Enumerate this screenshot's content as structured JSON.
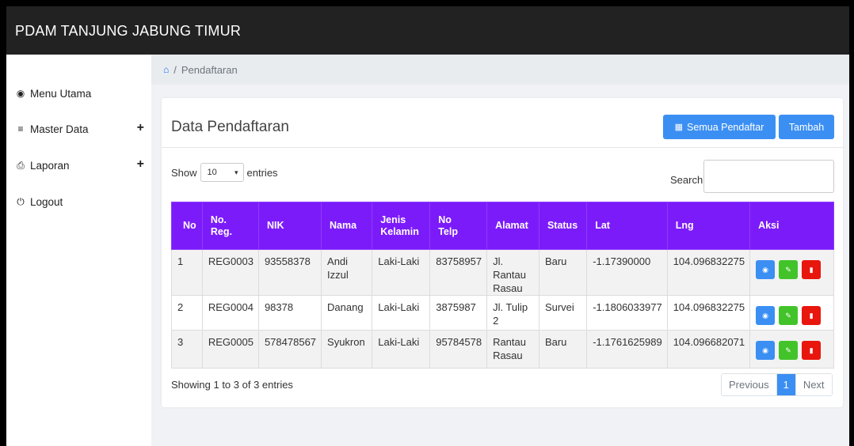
{
  "app": {
    "title": "PDAM TANJUNG JABUNG TIMUR"
  },
  "sidebar": {
    "items": [
      {
        "label": "Menu Utama",
        "icon": "dashboard-icon",
        "glyph": "◉",
        "expandable": false
      },
      {
        "label": "Master Data",
        "icon": "database-icon",
        "glyph": "≡",
        "expandable": true
      },
      {
        "label": "Laporan",
        "icon": "print-icon",
        "glyph": "⎙",
        "expandable": true
      },
      {
        "label": "Logout",
        "icon": "power-icon",
        "glyph": "⏻",
        "expandable": false
      }
    ],
    "expand_glyph": "+"
  },
  "breadcrumb": {
    "home_glyph": "⌂",
    "separator": "/",
    "current": "Pendaftaran"
  },
  "card": {
    "title": "Data Pendaftaran",
    "buttons": {
      "all_label": "Semua Pendaftar",
      "add_label": "Tambah",
      "map_glyph": "▦"
    }
  },
  "length_menu": {
    "show": "Show",
    "value": "10",
    "entries": "entries",
    "caret": "▾"
  },
  "search": {
    "label": "Search:",
    "value": ""
  },
  "table": {
    "columns": [
      "No",
      "No. Reg.",
      "NIK",
      "Nama",
      "Jenis Kelamin",
      "No Telp",
      "Alamat",
      "Status",
      "Lat",
      "Lng",
      "Aksi"
    ],
    "rows": [
      {
        "no": "1",
        "reg": "REG0003",
        "nik": "93558378",
        "nama": "Andi Izzul",
        "jk": "Laki-Laki",
        "telp": "83758957",
        "alamat": "Jl. Rantau Rasau",
        "status": "Baru",
        "lat": "-1.17390000",
        "lng": "104.096832275"
      },
      {
        "no": "2",
        "reg": "REG0004",
        "nik": "98378",
        "nama": "Danang",
        "jk": "Laki-Laki",
        "telp": "3875987",
        "alamat": "Jl. Tulip 2",
        "status": "Survei",
        "lat": "-1.1806033977",
        "lng": "104.096832275"
      },
      {
        "no": "3",
        "reg": "REG0005",
        "nik": "578478567",
        "nama": "Syukron",
        "jk": "Laki-Laki",
        "telp": "95784578",
        "alamat": "Rantau Rasau",
        "status": "Baru",
        "lat": "-1.1761625989",
        "lng": "104.096682071"
      }
    ],
    "action_glyphs": {
      "view": "◉",
      "edit": "✎",
      "delete": "▮"
    }
  },
  "footer": {
    "info": "Showing 1 to 3 of 3 entries",
    "pager": {
      "prev": "Previous",
      "current": "1",
      "next": "Next"
    }
  },
  "colors": {
    "topbar": "#222222",
    "header_purple": "#7c1bfa",
    "primary": "#3b8ff3",
    "success": "#43c32a",
    "danger": "#e8160d"
  }
}
